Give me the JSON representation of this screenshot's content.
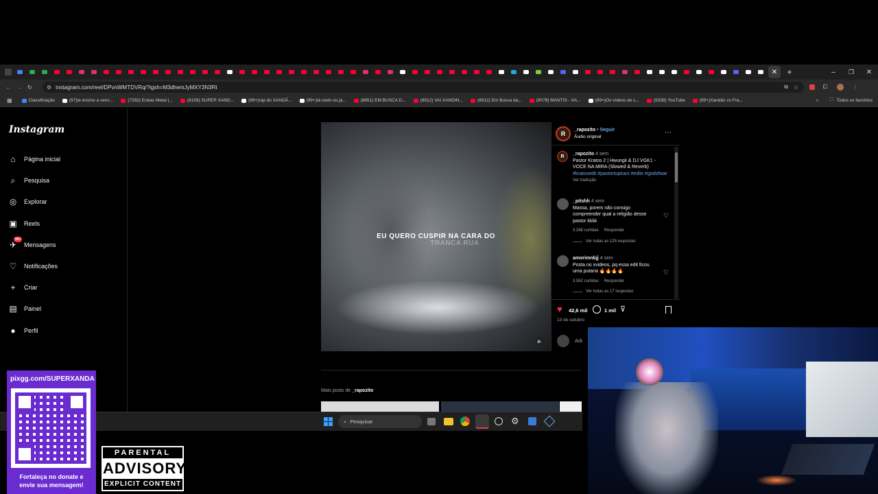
{
  "browser": {
    "url": "instagram.com/reel/DPvnWMTDVRq/?igsh=M3dhemJyMXY3N3Rt",
    "bookmarks": [
      {
        "label": "Classificação",
        "color": "#4285f4"
      },
      {
        "label": "(97)te ensino a venc...",
        "color": "#ffffff"
      },
      {
        "label": "(7292) Enéas Metal |...",
        "color": "#ff0033"
      },
      {
        "label": "(8159) SUPER XAND...",
        "color": "#ff0033"
      },
      {
        "label": "(99+)rap do XANDÃ...",
        "color": "#ffffff"
      },
      {
        "label": "(99+)tá cedo ou já...",
        "color": "#ffffff"
      },
      {
        "label": "(8851) EM BUSCA D...",
        "color": "#ff0033"
      },
      {
        "label": "(8912) VAI XANDIN...",
        "color": "#ff0033"
      },
      {
        "label": "(8912) Em Busca da...",
        "color": "#ff0033"
      },
      {
        "label": "(9078) MANTIS - XA...",
        "color": "#ff0033"
      },
      {
        "label": "(99+)Os vídeos de c...",
        "color": "#ffffff"
      },
      {
        "label": "(9338) YouTube",
        "color": "#ff0033"
      },
      {
        "label": "(99+)Xandão vs Fra...",
        "color": "#ff0033"
      }
    ],
    "all_bookmarks": "Todos os favoritos"
  },
  "instagram": {
    "logo": "Instagram",
    "nav": [
      {
        "label": "Página inicial",
        "icon": "home-icon"
      },
      {
        "label": "Pesquisa",
        "icon": "search-icon"
      },
      {
        "label": "Explorar",
        "icon": "compass-icon"
      },
      {
        "label": "Reels",
        "icon": "reels-icon"
      },
      {
        "label": "Mensagens",
        "icon": "messages-icon",
        "badge": "99+"
      },
      {
        "label": "Notificações",
        "icon": "heart-icon"
      },
      {
        "label": "Criar",
        "icon": "plus-icon"
      },
      {
        "label": "Painel",
        "icon": "dashboard-icon"
      },
      {
        "label": "Perfil",
        "icon": "avatar-icon"
      }
    ],
    "video_caption_line1": "EU QUERO CUSPIR NA CARA DO",
    "video_caption_line2": "TRANCA RUA",
    "post": {
      "username": "_rapozito",
      "follow": "Seguir",
      "separator": "•",
      "audio": "Áudio original",
      "caption": {
        "username": "_rapozito",
        "time": "4 sem",
        "text": "Pastor Kratos 2 | Hwungii & DJ VGK1 - VOCE NA MIRA (Slowed & Reverb)",
        "tags": "#kratosedit #pastortupirani #edits #godofwar",
        "translate": "Ver tradução"
      },
      "comments": [
        {
          "username": "_pitshh",
          "time": "4 sem",
          "text": "Massa, porem não consigo compreender qual a religião desse pastor kkkk",
          "likes": "3.268 curtidas",
          "reply": "Responder",
          "view_replies": "Ver todas as 125 respostas"
        },
        {
          "username": "amorimnbjj",
          "time": "4 sem",
          "text": "Posta no xvideos, pq essa edit ficou uma putaria 🔥🔥🔥🔥",
          "likes": "3.562 curtidas",
          "reply": "Responder",
          "view_replies": "Ver todas as 17 respostas"
        }
      ],
      "like_count": "42,6 mil",
      "comment_count": "1 mil",
      "date": "13 de outubro",
      "add_comment": "Adi"
    },
    "more_posts_label": "Mais posts de",
    "more_posts_user": "_rapozito"
  },
  "taskbar": {
    "search_placeholder": "Pesquisar"
  },
  "overlay": {
    "qr_url": "pixgg.com/SUPERXANDA",
    "qr_caption": "Fortaleça no donate e envie sua mensagem!",
    "pa_line1": "PARENTAL",
    "pa_line2": "ADVISORY",
    "pa_line3": "EXPLICIT CONTENT"
  },
  "colors": {
    "ig_blue": "#0095f6",
    "like_red": "#ff3040",
    "qr_purple": "#6a2bd0"
  }
}
